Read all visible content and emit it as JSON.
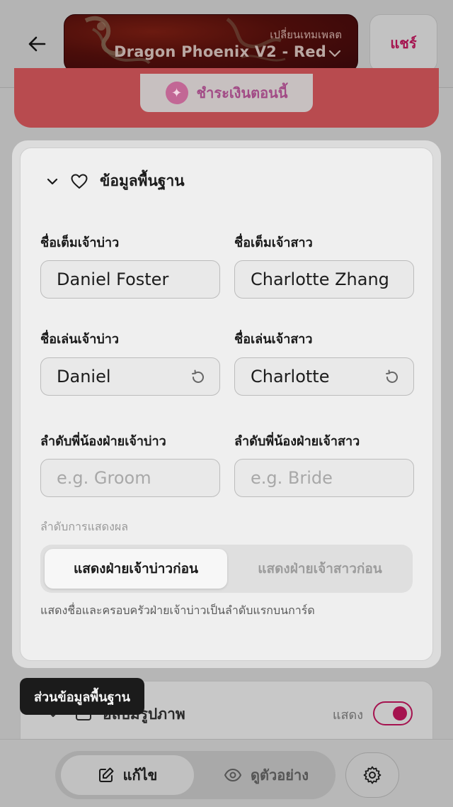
{
  "header": {
    "template_sub": "เปลี่ยนเทมเพลต",
    "template_name": "Dragon Phoenix V2 - Red",
    "share_label": "แชร์"
  },
  "promo": {
    "pay_label": "ชำระเงินตอนนี้"
  },
  "basic_info": {
    "title": "ข้อมูลพื้นฐาน",
    "groom_full_name_label": "ชื่อเต็มเจ้าบ่าว",
    "groom_full_name": "Daniel Foster",
    "bride_full_name_label": "ชื่อเต็มเจ้าสาว",
    "bride_full_name": "Charlotte Zhang",
    "groom_nickname_label": "ชื่อเล่นเจ้าบ่าว",
    "groom_nickname": "Daniel",
    "bride_nickname_label": "ชื่อเล่นเจ้าสาว",
    "bride_nickname": "Charlotte",
    "groom_sibling_label": "ลำดับพี่น้องฝ่ายเจ้าบ่าว",
    "groom_sibling_placeholder": "e.g. Groom",
    "bride_sibling_label": "ลำดับพี่น้องฝ่ายเจ้าสาว",
    "bride_sibling_placeholder": "e.g. Bride",
    "display_order_label": "ลำดับการแสดงผล",
    "order_groom_first": "แสดงฝ่ายเจ้าบ่าวก่อน",
    "order_bride_first": "แสดงฝ่ายเจ้าสาวก่อน",
    "order_help": "แสดงชื่อและครอบครัวฝ่ายเจ้าบ่าวเป็นลำดับแรกบนการ์ด"
  },
  "photo_section": {
    "title": "อัลบั้มรูปภาพ",
    "show_label": "แสดง",
    "visible": true
  },
  "tooltip": {
    "text": "ส่วนข้อมูลพื้นฐาน"
  },
  "bottom_nav": {
    "edit_label": "แก้ไข",
    "preview_label": "ดูตัวอย่าง"
  },
  "colors": {
    "accent": "#a5134f",
    "template_bg": "#4a0d0a"
  }
}
